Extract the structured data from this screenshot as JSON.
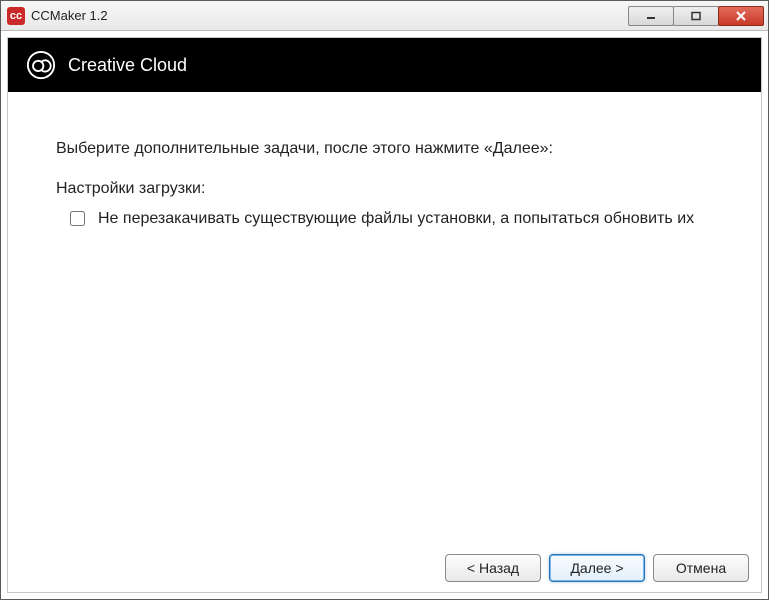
{
  "window": {
    "title": "CCMaker 1.2"
  },
  "header": {
    "product": "Creative Cloud"
  },
  "body": {
    "instruction": "Выберите дополнительные задачи, после этого нажмите «Далее»:",
    "section_label": "Настройки загрузки:",
    "checkbox_label": "Не перезакачивать существующие файлы установки, а попытаться обновить их"
  },
  "buttons": {
    "back": "< Назад",
    "next": "Далее >",
    "cancel": "Отмена"
  }
}
